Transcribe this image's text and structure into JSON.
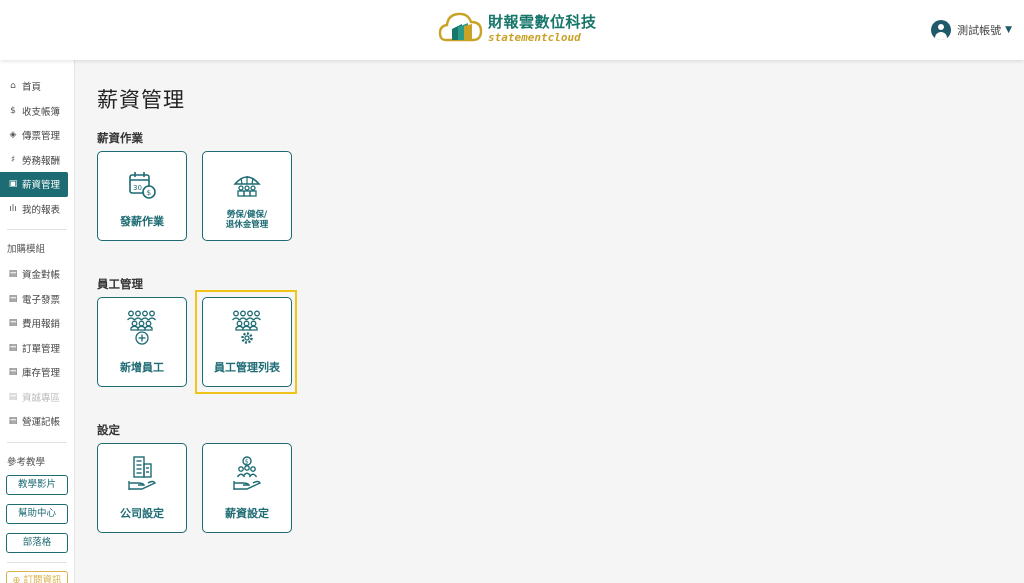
{
  "header": {
    "brand_cn": "財報雲數位科技",
    "brand_en": "statementcloud",
    "user_label": "測試帳號",
    "caret": "▼"
  },
  "sidebar": {
    "items": [
      {
        "icon": "⌂",
        "label": "首頁"
      },
      {
        "icon": "$",
        "label": "收支帳簿"
      },
      {
        "icon": "◈",
        "label": "傳票管理"
      },
      {
        "icon": "♯",
        "label": "勞務報酬"
      },
      {
        "icon": "▣",
        "label": "薪資管理",
        "active": true
      },
      {
        "icon": "ılı",
        "label": "我的報表"
      }
    ],
    "addon_label": "加購模組",
    "addons": [
      {
        "icon": "▤",
        "label": "資金對帳"
      },
      {
        "icon": "▤",
        "label": "電子發票"
      },
      {
        "icon": "▤",
        "label": "費用報銷"
      },
      {
        "icon": "▤",
        "label": "訂單管理"
      },
      {
        "icon": "▤",
        "label": "庫存管理"
      },
      {
        "icon": "▤",
        "label": "資誠專區",
        "disabled": true
      },
      {
        "icon": "▤",
        "label": "營運記帳"
      }
    ],
    "ref_label": "參考教學",
    "ref_buttons": [
      "教學影片",
      "幫助中心",
      "部落格"
    ],
    "subscribe_label": "訂閱資訊"
  },
  "main": {
    "page_title": "薪資管理",
    "sections": [
      {
        "title": "薪資作業",
        "cards": [
          "發薪作業",
          "勞保/健保/\n退休金管理"
        ]
      },
      {
        "title": "員工管理",
        "cards": [
          "新增員工",
          "員工管理列表"
        ]
      },
      {
        "title": "設定",
        "cards": [
          "公司設定",
          "薪資設定"
        ]
      }
    ]
  },
  "colors": {
    "primary": "#1d6b73",
    "accent_gold": "#c9a227",
    "highlight": "#f0c419"
  }
}
